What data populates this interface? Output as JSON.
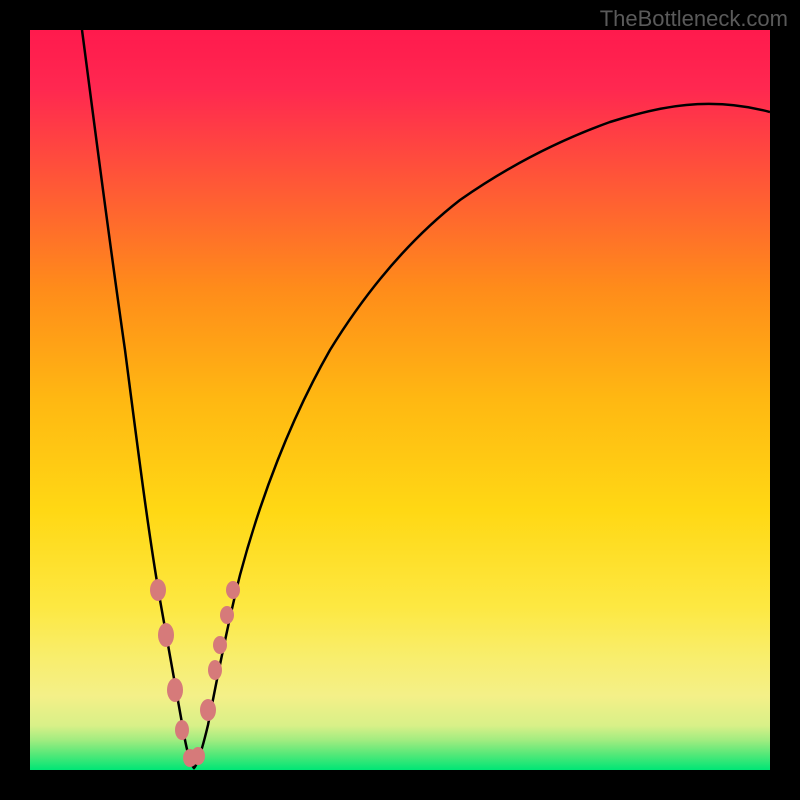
{
  "watermark": "TheBottleneck.com",
  "chart_data": {
    "type": "line",
    "title": "",
    "xlabel": "",
    "ylabel": "",
    "xlim": [
      0,
      100
    ],
    "ylim": [
      0,
      100
    ],
    "description": "Bottleneck percentage curve with V-shape minimum",
    "gradient_colors": {
      "top": "#ff1744",
      "mid_high": "#ff5722",
      "mid": "#ffc107",
      "mid_low": "#ffeb3b",
      "low": "#f4ee6a",
      "bottom": "#00e676"
    },
    "series": [
      {
        "name": "bottleneck-curve",
        "x": [
          7,
          8,
          10,
          12,
          14,
          16,
          18,
          19,
          20,
          21,
          22,
          23,
          24,
          26,
          28,
          30,
          35,
          40,
          45,
          50,
          55,
          60,
          65,
          70,
          75,
          80,
          85,
          90,
          95,
          100
        ],
        "y": [
          100,
          95,
          82,
          70,
          58,
          45,
          30,
          22,
          12,
          5,
          2,
          5,
          12,
          25,
          36,
          45,
          58,
          67,
          73,
          78,
          82,
          85,
          87,
          89,
          90,
          91,
          92,
          92.5,
          93,
          88
        ]
      }
    ],
    "markers": {
      "name": "highlight-points",
      "color": "#d87878",
      "points": [
        {
          "x": 17.5,
          "y": 28
        },
        {
          "x": 18.5,
          "y": 20
        },
        {
          "x": 19.5,
          "y": 10
        },
        {
          "x": 20.5,
          "y": 4
        },
        {
          "x": 21.5,
          "y": 2
        },
        {
          "x": 22.5,
          "y": 4
        },
        {
          "x": 24,
          "y": 14
        },
        {
          "x": 25,
          "y": 20
        },
        {
          "x": 25.5,
          "y": 24
        },
        {
          "x": 26.5,
          "y": 28
        },
        {
          "x": 27,
          "y": 30
        }
      ]
    }
  }
}
